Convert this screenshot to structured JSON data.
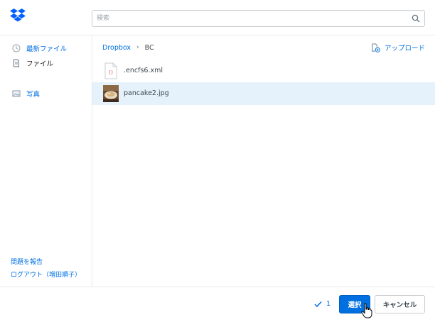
{
  "search": {
    "placeholder": "検索"
  },
  "sidebar": {
    "nav": [
      {
        "label": "最新ファイル",
        "icon": "clock-icon"
      },
      {
        "label": "ファイル",
        "icon": "file-icon"
      },
      {
        "label": "写真",
        "icon": "photo-icon"
      }
    ],
    "report_label": "問題を報告",
    "logout_label": "ログアウト（増田順子）"
  },
  "breadcrumb": {
    "root": "Dropbox",
    "separator": "›",
    "current": "BC"
  },
  "upload_label": "アップロード",
  "files": [
    {
      "name": ".encfs6.xml",
      "icon": "xml-file-icon",
      "selected": false
    },
    {
      "name": "pancake2.jpg",
      "icon": "image-thumbnail",
      "selected": true
    }
  ],
  "footer": {
    "selected_count": "1",
    "select_label": "選択",
    "cancel_label": "キャンセル"
  },
  "colors": {
    "accent": "#0070e0",
    "selected_row": "#e5f1fb",
    "border": "#e6e8eb"
  }
}
